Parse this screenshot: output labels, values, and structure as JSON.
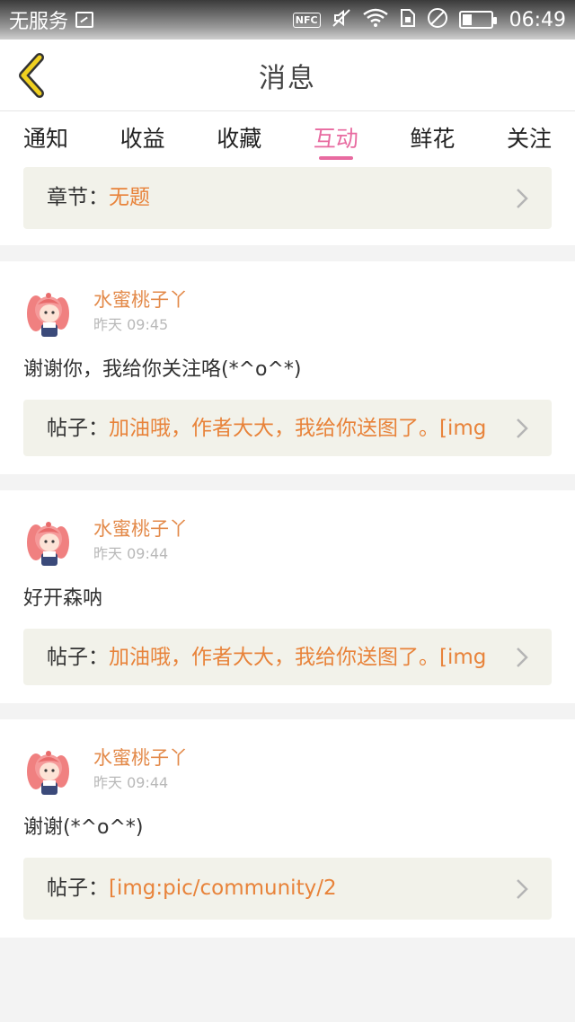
{
  "status_bar": {
    "carrier": "无服务",
    "nfc": "NFC",
    "time": "06:49",
    "icons": [
      "image-icon",
      "nfc-icon",
      "mute-icon",
      "wifi-icon",
      "sim-icon",
      "no-disturb-icon",
      "battery-icon"
    ]
  },
  "header": {
    "title": "消息",
    "back_icon": "chevron-left-icon",
    "accent_color": "#f0d020"
  },
  "tabs": [
    {
      "label": "通知"
    },
    {
      "label": "收益"
    },
    {
      "label": "收藏"
    },
    {
      "label": "互动",
      "active": true
    },
    {
      "label": "鲜花"
    },
    {
      "label": "关注"
    }
  ],
  "colors": {
    "accent_pink": "#e86aa0",
    "link_orange": "#e8833a",
    "ref_bg": "#f2f2ea"
  },
  "partial_card": {
    "ref_label": "章节：",
    "ref_text": "无题"
  },
  "messages": [
    {
      "username": "水蜜桃子丫",
      "timestamp": "昨天 09:45",
      "comment": "谢谢你，我给你关注咯(*^o^*)",
      "ref_label": "帖子：",
      "ref_text": "加油哦，作者大大，我给你送图了。[img"
    },
    {
      "username": "水蜜桃子丫",
      "timestamp": "昨天 09:44",
      "comment": "好开森呐",
      "ref_label": "帖子：",
      "ref_text": "加油哦，作者大大，我给你送图了。[img"
    },
    {
      "username": "水蜜桃子丫",
      "timestamp": "昨天 09:44",
      "comment": "谢谢(*^o^*)",
      "ref_label": "帖子：",
      "ref_text": "[img:pic/community/2"
    }
  ]
}
